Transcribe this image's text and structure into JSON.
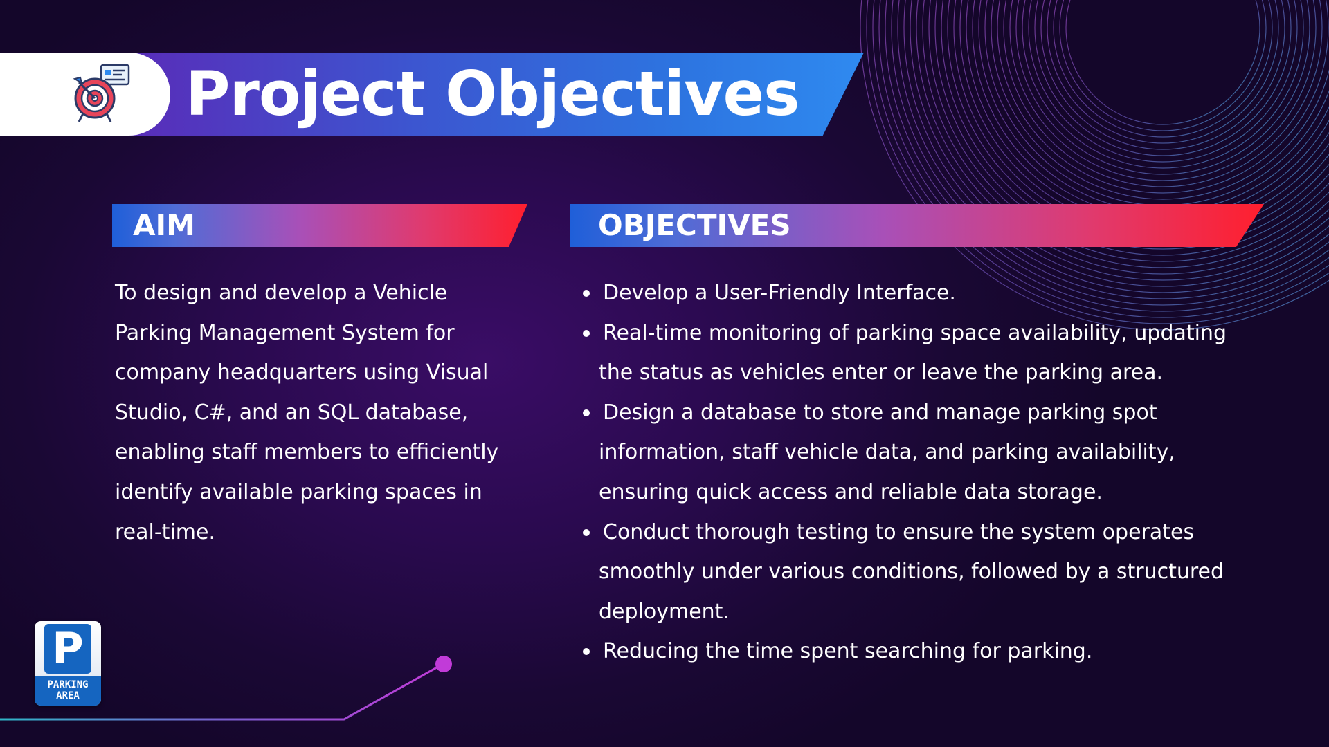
{
  "title": {
    "text": "Project Objectives",
    "icon": "target-icon"
  },
  "aim": {
    "heading": "AIM",
    "lines": [
      "To design and develop a Vehicle",
      "Parking Management System for",
      "company headquarters using Visual",
      "Studio, C#, and an SQL database,",
      "enabling staff members to efficiently",
      "identify available parking spaces in",
      "real-time."
    ]
  },
  "objectives": {
    "heading": "OBJECTIVES",
    "items": [
      {
        "lines": [
          "Develop a User-Friendly Interface."
        ]
      },
      {
        "lines": [
          "Real-time monitoring of parking space availability, updating",
          "the status as vehicles enter or leave the parking area."
        ]
      },
      {
        "lines": [
          "Design a database to store and manage parking spot",
          "information, staff vehicle data, and parking availability,",
          "ensuring quick access and reliable data storage."
        ]
      },
      {
        "lines": [
          "Conduct thorough testing to ensure the system operates",
          "smoothly under various conditions, followed by a structured",
          "deployment."
        ]
      },
      {
        "lines": [
          "Reducing the time spent searching for parking."
        ]
      }
    ]
  },
  "logo": {
    "letter": "P",
    "caption_line1": "PARKING",
    "caption_line2": "AREA",
    "icon": "parking-sign-icon"
  },
  "colors": {
    "background": "#1a0834",
    "title_gradient_start": "#5a2bb8",
    "title_gradient_end": "#2f8af0",
    "header_gradient_start": "#1f5fd9",
    "header_gradient_mid": "#a850b8",
    "header_gradient_end": "#ff1f2e",
    "accent_dot": "#c13bd8",
    "parking_blue": "#1565c0"
  }
}
